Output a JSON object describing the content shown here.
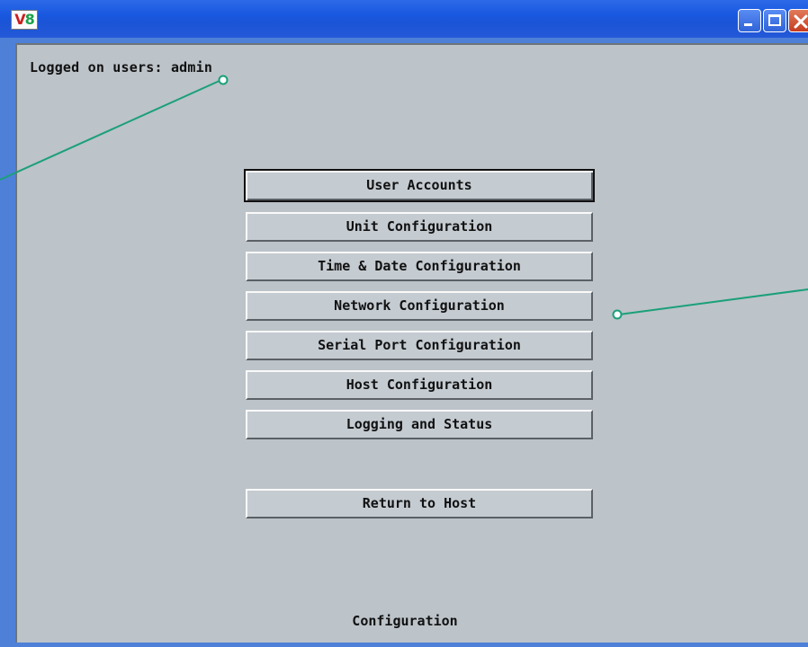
{
  "window": {
    "icon_text_v": "V",
    "icon_text_n": "8",
    "accent_color": "#1858e0",
    "client_bg": "#bcc3c9"
  },
  "header": {
    "logged_on_label": "Logged on users:",
    "logged_on_user": "admin"
  },
  "menu": {
    "items": [
      {
        "label": "User Accounts"
      },
      {
        "label": "Unit Configuration"
      },
      {
        "label": "Time & Date Configuration"
      },
      {
        "label": "Network Configuration"
      },
      {
        "label": "Serial Port Configuration"
      },
      {
        "label": "Host Configuration"
      },
      {
        "label": "Logging and Status"
      }
    ],
    "return_label": "Return to Host"
  },
  "status": {
    "text": "Configuration"
  },
  "callouts": {
    "color": "#1aa079"
  }
}
